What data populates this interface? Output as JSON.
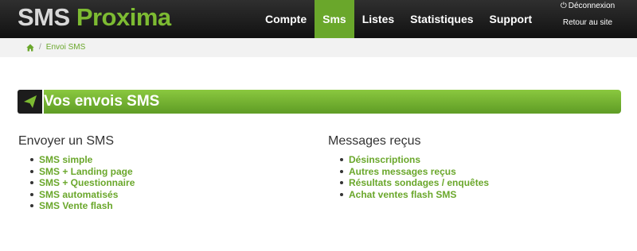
{
  "logo": {
    "part1": "SMS",
    "part2": "Proxima"
  },
  "nav": {
    "items": [
      {
        "label": "Compte"
      },
      {
        "label": "Sms"
      },
      {
        "label": "Listes"
      },
      {
        "label": "Statistiques"
      },
      {
        "label": "Support"
      }
    ],
    "active": "Sms"
  },
  "header_links": {
    "logout": "Déconnexion",
    "back": "Retour au site"
  },
  "breadcrumb": {
    "home_icon": "home-icon",
    "current": "Envoi SMS"
  },
  "banner": {
    "title": "Vos envois SMS",
    "icon": "paper-plane-icon"
  },
  "sections": {
    "send": {
      "title": "Envoyer un SMS",
      "items": [
        "SMS simple",
        "SMS + Landing page",
        "SMS + Questionnaire",
        "SMS automatisés",
        "SMS Vente flash"
      ]
    },
    "received": {
      "title": "Messages reçus",
      "items": [
        "Désinscriptions",
        "Autres messages reçus",
        "Résultats sondages / enquêtes",
        "Achat ventes flash SMS"
      ]
    }
  },
  "colors": {
    "accent": "#6aa72b",
    "topbar": "#1a1a1a",
    "text": "#333333"
  }
}
